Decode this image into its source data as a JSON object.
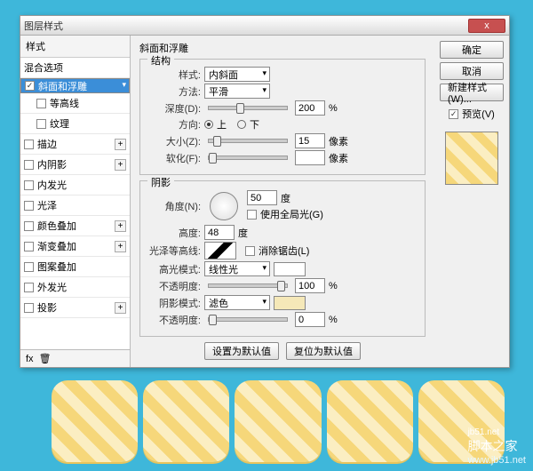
{
  "window": {
    "title": "图层样式",
    "close": "x"
  },
  "side": {
    "header": "样式",
    "blend": "混合选项",
    "items": [
      {
        "label": "斜面和浮雕",
        "checked": true,
        "selected": true,
        "plus": false
      },
      {
        "label": "等高线",
        "checked": false,
        "sub": true
      },
      {
        "label": "纹理",
        "checked": false,
        "sub": true
      },
      {
        "label": "描边",
        "checked": false,
        "plus": true
      },
      {
        "label": "内阴影",
        "checked": false,
        "plus": true
      },
      {
        "label": "内发光",
        "checked": false
      },
      {
        "label": "光泽",
        "checked": false
      },
      {
        "label": "颜色叠加",
        "checked": false,
        "plus": true
      },
      {
        "label": "渐变叠加",
        "checked": false,
        "plus": true
      },
      {
        "label": "图案叠加",
        "checked": false
      },
      {
        "label": "外发光",
        "checked": false
      },
      {
        "label": "投影",
        "checked": false,
        "plus": true
      }
    ],
    "footer": {
      "fx": "fx"
    }
  },
  "bevel": {
    "group": "斜面和浮雕",
    "struct": "结构",
    "style_l": "样式:",
    "style_v": "内斜面",
    "tech_l": "方法:",
    "tech_v": "平滑",
    "depth_l": "深度(D):",
    "depth_v": "200",
    "pct": "%",
    "dir_l": "方向:",
    "up": "上",
    "down": "下",
    "size_l": "大小(Z):",
    "size_v": "15",
    "px": "像素",
    "soft_l": "软化(F):",
    "soft_v": "",
    "soft_u": "像素"
  },
  "shade": {
    "group": "阴影",
    "angle_l": "角度(N):",
    "angle_v": "50",
    "deg": "度",
    "global": "使用全局光(G)",
    "alt_l": "高度:",
    "alt_v": "48",
    "gloss_l": "光泽等高线:",
    "anti": "消除锯齿(L)",
    "hmode_l": "高光模式:",
    "hmode_v": "线性光",
    "hcolor": "#ffffff",
    "hop_l": "不透明度:",
    "hop_v": "100",
    "smode_l": "阴影模式:",
    "smode_v": "滤色",
    "scolor": "#f5e8b8",
    "sop_l": "不透明度:",
    "sop_v": "0"
  },
  "actions": {
    "default": "设置为默认值",
    "reset": "复位为默认值"
  },
  "right": {
    "ok": "确定",
    "cancel": "取消",
    "newstyle": "新建样式(W)...",
    "preview": "预览(V)"
  },
  "watermark": {
    "top": "jb51.net",
    "bottom": "脚本之家",
    "sub": "www.jb51.net"
  }
}
